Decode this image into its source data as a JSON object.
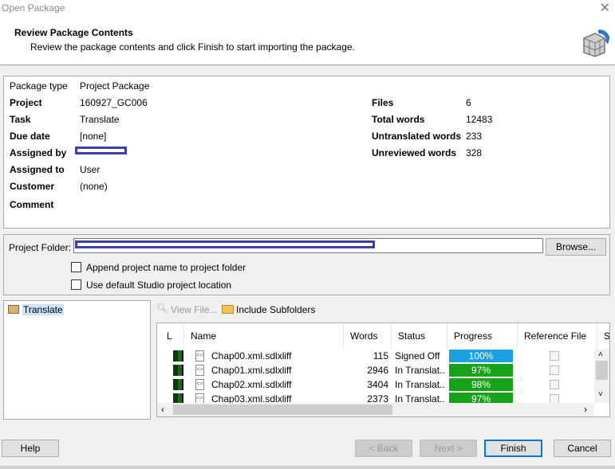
{
  "window": {
    "title": "Open Package",
    "close_icon": "close-icon"
  },
  "header": {
    "title": "Review Package Contents",
    "subtitle": "Review the package contents and click Finish to start importing the package.",
    "icon": "package-refresh-icon"
  },
  "info": {
    "left": [
      {
        "label": "Package type",
        "value": "Project Package"
      },
      {
        "label": "Project",
        "value": "160927_GC006"
      },
      {
        "label": "Task",
        "value": "Translate"
      },
      {
        "label": "Due date",
        "value": "[none]"
      },
      {
        "label": "Assigned by",
        "value": ""
      },
      {
        "label": "Assigned to",
        "value": "User"
      },
      {
        "label": "Customer",
        "value": "(none)"
      },
      {
        "label": "Comment",
        "value": ""
      }
    ],
    "right": [
      {
        "label": "Files",
        "value": "6"
      },
      {
        "label": "Total words",
        "value": "12483"
      },
      {
        "label": "Untranslated words",
        "value": "233"
      },
      {
        "label": "Unreviewed words",
        "value": "328"
      }
    ]
  },
  "folder": {
    "label": "Project Folder:",
    "value": "",
    "browse": "Browse...",
    "append_label": "Append project name to project folder",
    "append_checked": false,
    "default_label": "Use default Studio project location",
    "default_checked": false
  },
  "tree": {
    "items": [
      {
        "label": "Translate",
        "selected": true
      }
    ]
  },
  "toolbar": {
    "view_file": "View File...",
    "include_subfolders": "Include Subfolders"
  },
  "grid": {
    "columns": [
      "L",
      "Name",
      "Words",
      "Status",
      "Progress",
      "Reference File",
      "S"
    ],
    "rows": [
      {
        "name": "Chap00.xml.sdlxliff",
        "words": "115",
        "status": "Signed Off",
        "progress": "100%",
        "color": "#1ba1e2"
      },
      {
        "name": "Chap01.xml.sdlxliff",
        "words": "2946",
        "status": "In Translat...",
        "progress": "97%",
        "color": "#17a317"
      },
      {
        "name": "Chap02.xml.sdlxliff",
        "words": "3404",
        "status": "In Translat...",
        "progress": "98%",
        "color": "#17a317"
      },
      {
        "name": "Chap03.xml.sdlxliff",
        "words": "2373",
        "status": "In Translat...",
        "progress": "97%",
        "color": "#17a317"
      }
    ]
  },
  "buttons": {
    "help": "Help",
    "back": "< Back",
    "next": "Next >",
    "finish": "Finish",
    "cancel": "Cancel"
  }
}
